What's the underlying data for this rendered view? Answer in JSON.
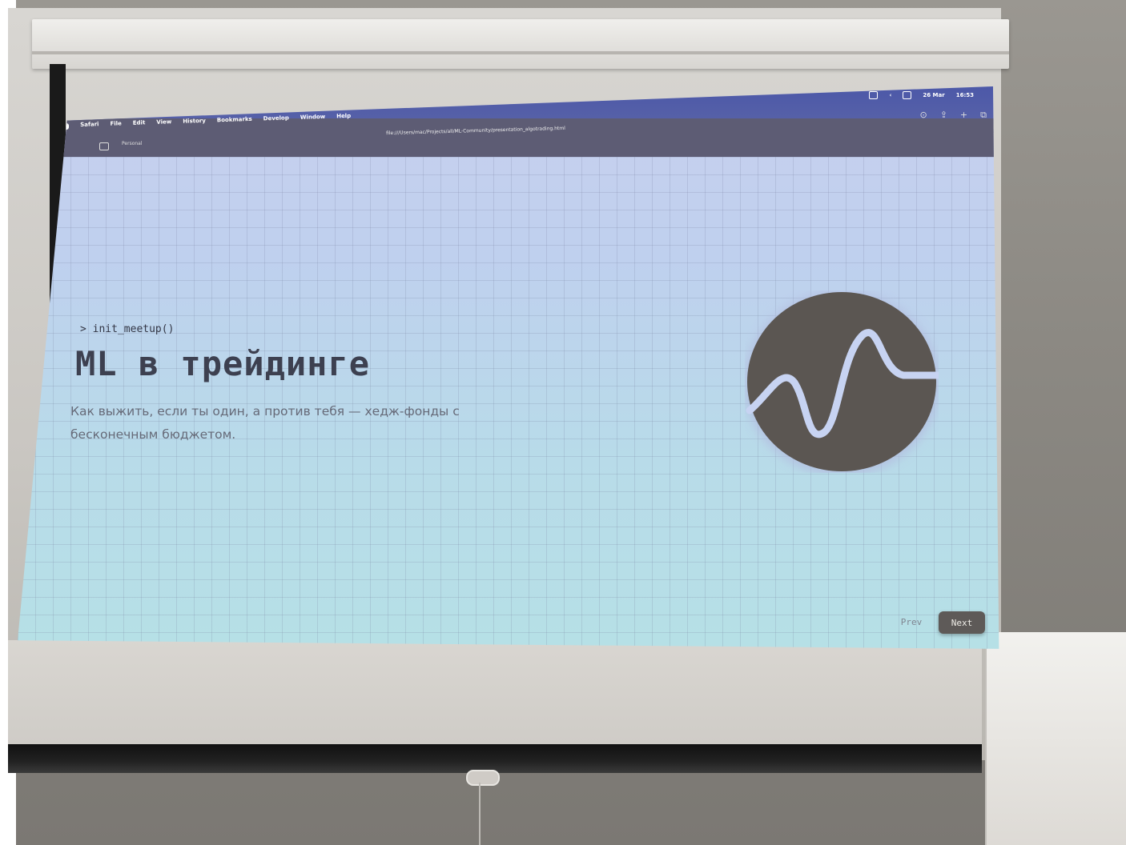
{
  "browser": {
    "app_name": "Safari",
    "menu": [
      "Safari",
      "File",
      "Edit",
      "View",
      "History",
      "Bookmarks",
      "Develop",
      "Window",
      "Help"
    ],
    "status_date": "26 Mar",
    "status_time": "16:53",
    "url": "file:///Users/mac/Projects/all/ML-Community/presentation_algotrading.html",
    "profile": "Personal"
  },
  "slide": {
    "prompt": "> init_meetup()",
    "title": "ML в трейдинге",
    "subtitle": "Как выжить, если ты один, а против тебя — хедж-фонды с бесконечным бюджетом.",
    "logo_icon": "wave-logo-icon",
    "colors": {
      "logo_bg": "#5b5652",
      "logo_wave": "#c7d3f2",
      "title": "#3d4050",
      "next_btn": "#5e5a58"
    }
  },
  "nav": {
    "prev_label": "Prev",
    "next_label": "Next"
  }
}
